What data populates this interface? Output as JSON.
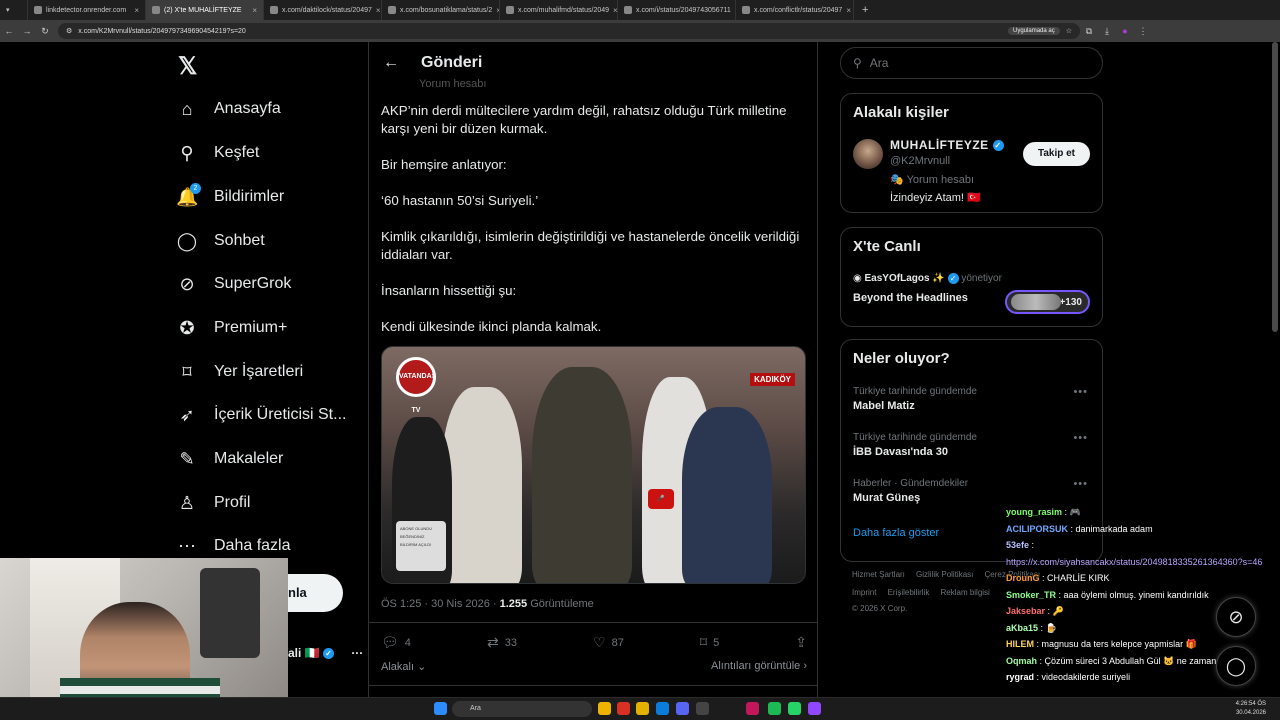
{
  "browser": {
    "tabs": [
      {
        "label": "linkdetector.onrender.com",
        "active": false
      },
      {
        "label": "(2) X'te MUHALİFTEYZE",
        "active": true
      },
      {
        "label": "x.com/daktilock/status/20497",
        "active": false
      },
      {
        "label": "x.com/bosunatiklama/status/2",
        "active": false
      },
      {
        "label": "x.com/muhalifmd/status/2049",
        "active": false
      },
      {
        "label": "x.com/i/status/2049743056711",
        "active": false
      },
      {
        "label": "x.com/conflictlr/status/20497",
        "active": false
      }
    ],
    "url": "x.com/K2Mrvnull/status/2049797349690454219?s=20",
    "app_pill": "Uygulamada aç"
  },
  "nav": {
    "items": [
      {
        "label": "Anasayfa",
        "icon": "home-icon",
        "glyph": "⌂"
      },
      {
        "label": "Keşfet",
        "icon": "search-icon",
        "glyph": "⚲"
      },
      {
        "label": "Bildirimler",
        "icon": "bell-icon",
        "glyph": "🔔",
        "badge": "2"
      },
      {
        "label": "Sohbet",
        "icon": "chat-icon",
        "glyph": "◯"
      },
      {
        "label": "SuperGrok",
        "icon": "grok-icon",
        "glyph": "⊘"
      },
      {
        "label": "Premium+",
        "icon": "premium-icon",
        "glyph": "✪"
      },
      {
        "label": "Yer İşaretleri",
        "icon": "bookmark-icon",
        "glyph": "⌑"
      },
      {
        "label": "İçerik Üreticisi St...",
        "icon": "rocket-icon",
        "glyph": "➶"
      },
      {
        "label": "Makaleler",
        "icon": "article-icon",
        "glyph": "✎"
      },
      {
        "label": "Profil",
        "icon": "profile-icon",
        "glyph": "♙"
      },
      {
        "label": "Daha fazla",
        "icon": "more-icon",
        "glyph": "⋯"
      }
    ],
    "post_button_partial": "nla",
    "account_partial": "ali 🇮🇹"
  },
  "post": {
    "header_title": "Gönderi",
    "faded_sub": "Yorum hesabı",
    "paragraphs": [
      "AKP’nin derdi mültecilere yardım değil, rahatsız olduğu Türk milletine karşı yeni bir düzen kurmak.",
      "Bir hemşire anlatıyor:",
      "‘60 hastanın 50’si Suriyeli.’",
      "Kimlik çıkarıldığı, isimlerin değiştirildiği ve hastanelerde öncelik verildiği iddiaları var.",
      "İnsanların hissettiği şu:",
      "Kendi ülkesinde ikinci planda kalmak."
    ],
    "media_badge": "KADIKÖY",
    "media_logo": "VATANDAŞ TV",
    "media_subscribe_lines": [
      "ABONE OLUNDU",
      "BEĞENDİNİZ",
      "BİLDİRİM AÇILDI"
    ],
    "time": "ÖS 1:25 · 30 Nis 2026 · ",
    "views": "1.255",
    "views_label": " Görüntüleme",
    "actions": {
      "replies": "4",
      "reposts": "33",
      "likes": "87",
      "bookmarks": "5"
    },
    "related_label": "Alakalı",
    "quotes_label": "Alıntıları görüntüle"
  },
  "right": {
    "search_placeholder": "Ara",
    "related_people_title": "Alakalı kişiler",
    "person": {
      "name": "MUHALİFTEYZE",
      "handle": "@K2Mrvnull",
      "tag": "Yorum hesabı",
      "bio": "İzindeyiz Atam! 🇹🇷",
      "follow_label": "Takip et"
    },
    "live_title": "X'te Canlı",
    "live": {
      "host": "EasYOfLagos ✨",
      "role": "yönetiyor",
      "title": "Beyond the Headlines",
      "listeners": "+130"
    },
    "whats_happening_title": "Neler oluyor?",
    "trends": [
      {
        "category": "Türkiye tarihinde gündemde",
        "name": "Mabel Matiz"
      },
      {
        "category": "Türkiye tarihinde gündemde",
        "name": "İBB Davası'nda 30"
      },
      {
        "category": "Haberler · Gündemdekiler",
        "name": "Murat Güneş"
      }
    ],
    "show_more": "Daha fazla göster",
    "footer": [
      "Hizmet Şartları",
      "Gizlilik Politikası",
      "Çerez Politikası",
      "Imprint",
      "Erişilebilirlik",
      "Reklam bilgisi",
      "© 2026 X Corp."
    ]
  },
  "chat": [
    {
      "user": "young_rasim",
      "msg": " : 🎮",
      "color": "#7cff6b"
    },
    {
      "user": "ACILIPORSUK",
      "msg": " : danimarkada adam",
      "color": "#6ea8ff"
    },
    {
      "user": "53efe",
      "msg": " :",
      "color": "#b8c1ff"
    },
    {
      "user": "",
      "msg": "https://x.com/siyahsancakx/status/2049818335261364360?s=46",
      "color": "#b9a6ff"
    },
    {
      "user": "DrounG",
      "msg": " : CHARLİE KIRK",
      "color": "#ff9c3a"
    },
    {
      "user": "Smoker_TR",
      "msg": " : aaa öylemi olmuş. yinemi kandırıldık",
      "color": "#8cff8c"
    },
    {
      "user": "Jaksebar",
      "msg": " : 🔑",
      "color": "#ff6f6f"
    },
    {
      "user": "aKba15",
      "msg": " : 🍺",
      "color": "#b0ffb0"
    },
    {
      "user": "HILEM",
      "msg": " : magnusu da ters kelepce yapmislar 🎁",
      "color": "#ffd45e"
    },
    {
      "user": "Oqmah",
      "msg": " : Çözüm süreci 3 Abdullah Gül 🐱 ne zaman gelir",
      "color": "#9dff9d"
    },
    {
      "user": "rygrad",
      "msg": " : videodakilerde suriyeli",
      "color": "#ffffff"
    }
  ],
  "taskbar": {
    "search": "Ara",
    "time": "4:26:54 ÖS",
    "date": "30.04.2026"
  }
}
